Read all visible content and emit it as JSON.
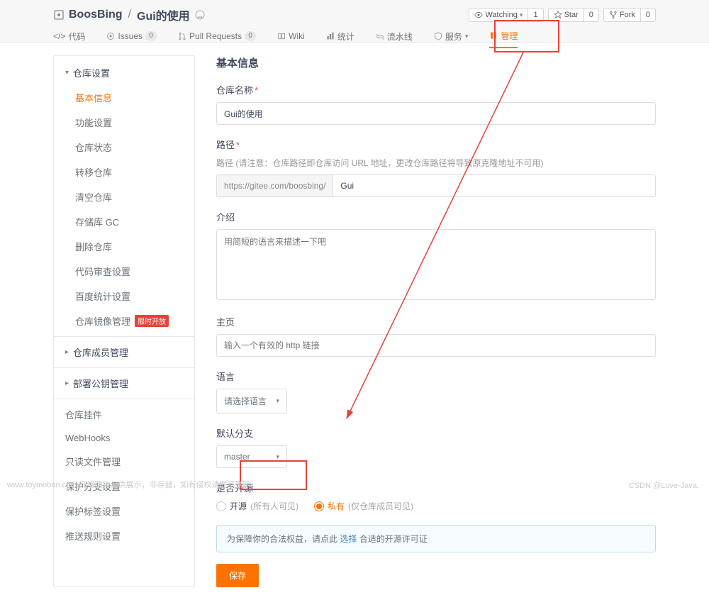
{
  "header": {
    "owner": "BoosBing",
    "repo": "Gui的使用",
    "watching_label": "Watching",
    "watching_count": "1",
    "star_label": "Star",
    "star_count": "0",
    "fork_label": "Fork",
    "fork_count": "0"
  },
  "tabs": {
    "code": "代码",
    "issues": "Issues",
    "issues_count": "0",
    "pulls": "Pull Requests",
    "pulls_count": "0",
    "wiki": "Wiki",
    "stats": "统计",
    "pipeline": "流水线",
    "services": "服务",
    "admin": "管理"
  },
  "sidebar": {
    "group_repo": "仓库设置",
    "basic": "基本信息",
    "feature": "功能设置",
    "status": "仓库状态",
    "transfer": "转移仓库",
    "clear": "清空仓库",
    "gc": "存储库 GC",
    "delete": "删除仓库",
    "review": "代码审查设置",
    "baidu": "百度统计设置",
    "mirror": "仓库镜像管理",
    "mirror_tag": "限时开放",
    "group_member": "仓库成员管理",
    "group_key": "部署公钥管理",
    "hooks_group": "仓库挂件",
    "webhooks": "WebHooks",
    "readonly": "只读文件管理",
    "branch": "保护分支设置",
    "tag": "保护标签设置",
    "push": "推送规则设置"
  },
  "form": {
    "title": "基本信息",
    "name_label": "仓库名称",
    "name_value": "Gui的使用",
    "path_label": "路径",
    "path_hint": "路径 (请注意：仓库路径即仓库访问 URL 地址，更改仓库路径将导致原克隆地址不可用)",
    "path_prefix": "https://gitee.com/boosbing/",
    "path_value": "Gui",
    "intro_label": "介绍",
    "intro_placeholder": "用简短的语言来描述一下吧",
    "home_label": "主页",
    "home_placeholder": "输入一个有效的 http 链接",
    "lang_label": "语言",
    "lang_value": "请选择语言",
    "branch_label": "默认分支",
    "branch_value": "master",
    "open_label": "是否开源",
    "open_public": "开源",
    "open_public_hint": "(所有人可见)",
    "open_private": "私有",
    "open_private_hint": "(仅仓库成员可见)",
    "notice_pre": "为保障你的合法权益，请点此 ",
    "notice_link": "选择",
    "notice_post": " 合适的开源许可证",
    "save": "保存"
  },
  "footer": {
    "left": "www.toymoban.com  网络图片仅供展示，非存储，如有侵权请联系删除。",
    "right": "CSDN @Love-Java."
  }
}
